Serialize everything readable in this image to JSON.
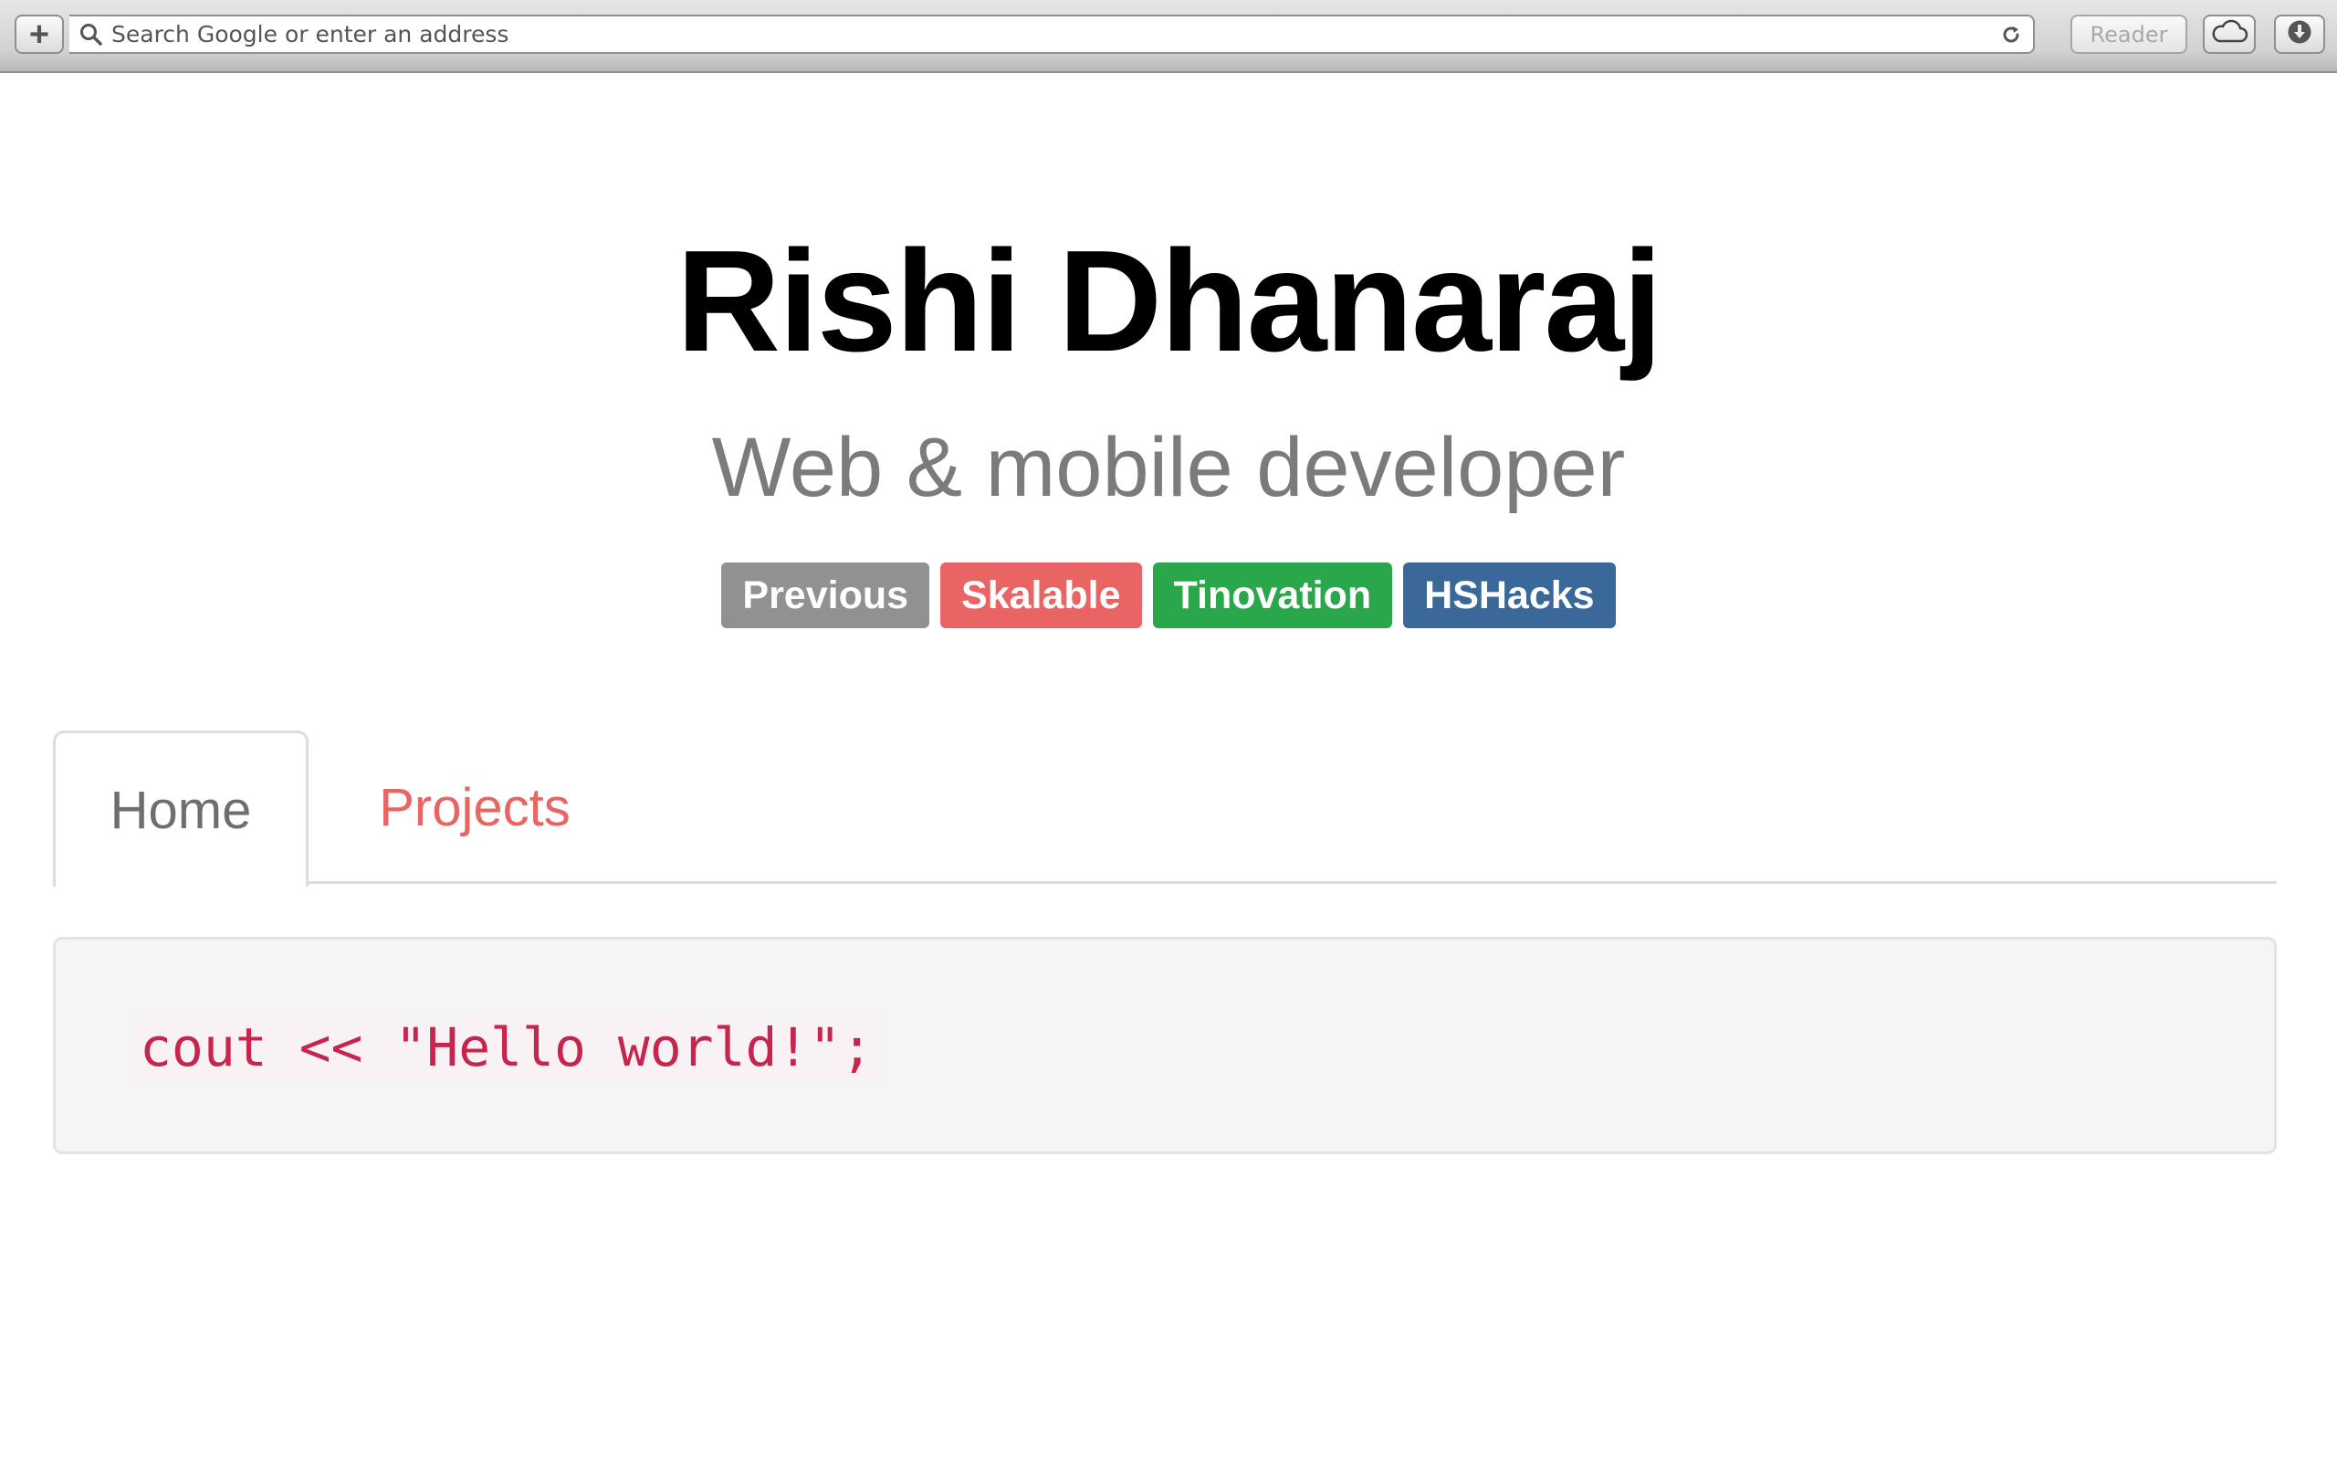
{
  "browser": {
    "address_placeholder": "Search Google or enter an address",
    "reader_label": "Reader",
    "new_tab_label": "+",
    "icons": [
      "plus-icon",
      "search-icon",
      "reload-icon",
      "icloud-icon",
      "download-icon"
    ]
  },
  "header": {
    "name": "Rishi Dhanaraj",
    "subtitle": "Web & mobile developer"
  },
  "badges": [
    {
      "label": "Previous",
      "color": "#919191"
    },
    {
      "label": "Skalable",
      "color": "#e96564"
    },
    {
      "label": "Tinovation",
      "color": "#2aa74b"
    },
    {
      "label": "HSHacks",
      "color": "#3a6899"
    }
  ],
  "tabs": [
    {
      "label": "Home",
      "active": true
    },
    {
      "label": "Projects",
      "active": false
    }
  ],
  "code": {
    "snippet": "cout << \"Hello world!\";"
  },
  "colors": {
    "accent": "#e96564",
    "code_text": "#c7254e",
    "code_background": "#f9f2f4",
    "well_background": "#f5f5f5"
  }
}
